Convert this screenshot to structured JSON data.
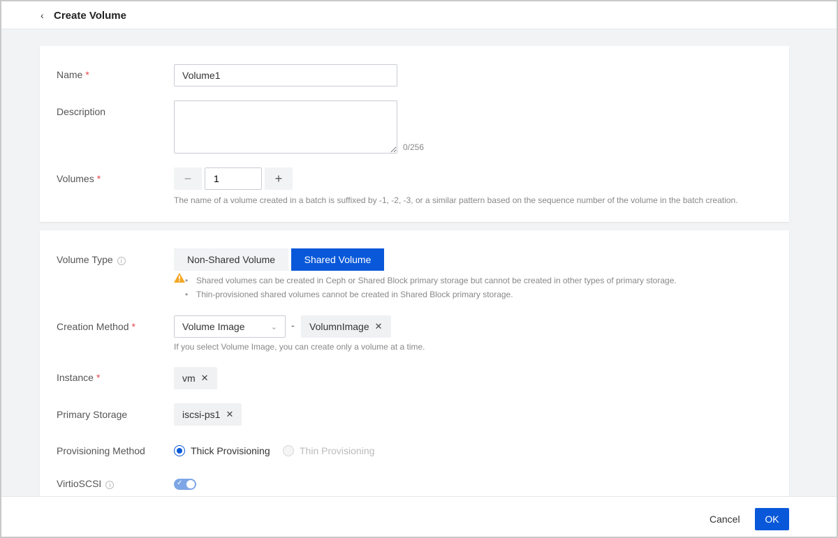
{
  "header": {
    "title": "Create Volume"
  },
  "form": {
    "name": {
      "label": "Name",
      "value": "Volume1"
    },
    "description": {
      "label": "Description",
      "value": "",
      "counter": "0/256"
    },
    "volumes": {
      "label": "Volumes",
      "value": "1",
      "hint": "The name of a volume created in a batch is suffixed by -1, -2, -3, or a similar pattern based on the sequence number of the volume in the batch creation."
    },
    "volume_type": {
      "label": "Volume Type",
      "options": [
        "Non-Shared Volume",
        "Shared Volume"
      ],
      "selected": "Shared Volume",
      "notes": [
        "Shared volumes can be created in Ceph or Shared Block primary storage but cannot be created in other types of primary storage.",
        "Thin-provisioned shared volumes cannot be created in Shared Block primary storage."
      ]
    },
    "creation_method": {
      "label": "Creation Method",
      "selected": "Volume Image",
      "separator": "-",
      "image_tag": "VolumnImage",
      "hint": "If you select Volume Image, you can create only a volume at a time."
    },
    "instance": {
      "label": "Instance",
      "tag": "vm"
    },
    "primary_storage": {
      "label": "Primary Storage",
      "tag": "iscsi-ps1"
    },
    "provisioning": {
      "label": "Provisioning Method",
      "options": [
        "Thick Provisioning",
        "Thin Provisioning"
      ],
      "selected": "Thick Provisioning"
    },
    "virtio_scsi": {
      "label": "VirtioSCSI",
      "enabled": true
    }
  },
  "required_mark": "*",
  "footer": {
    "cancel_label": "Cancel",
    "ok_label": "OK"
  },
  "colors": {
    "primary": "#0958d9",
    "required": "#e5484d",
    "warning": "#f5a623"
  }
}
